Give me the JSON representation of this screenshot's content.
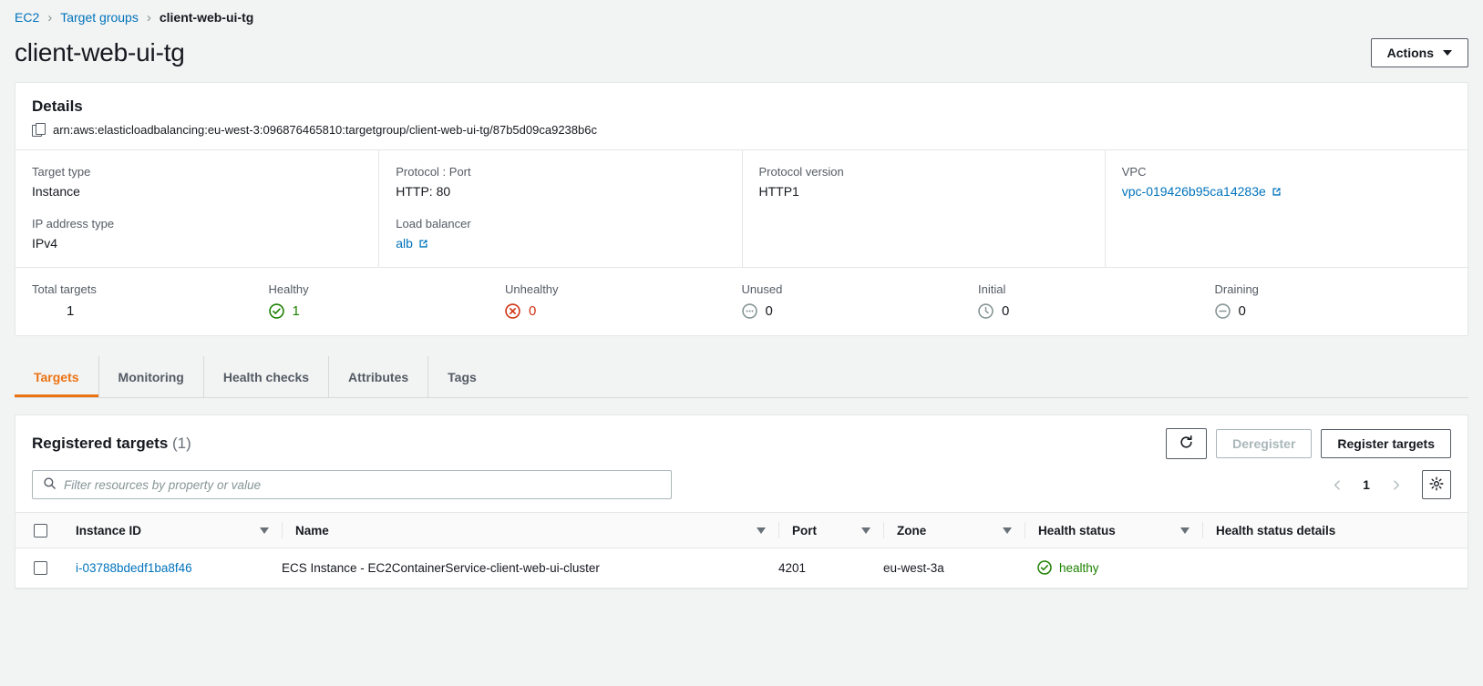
{
  "breadcrumb": {
    "items": [
      {
        "label": "EC2",
        "link": true
      },
      {
        "label": "Target groups",
        "link": true
      },
      {
        "label": "client-web-ui-tg",
        "link": false
      }
    ],
    "separator": "›"
  },
  "header": {
    "title": "client-web-ui-tg",
    "actions_label": "Actions"
  },
  "details": {
    "title": "Details",
    "arn": "arn:aws:elasticloadbalancing:eu-west-3:096876465810:targetgroup/client-web-ui-tg/87b5d09ca9238b6c",
    "attributes": [
      {
        "label": "Target type",
        "value": "Instance"
      },
      {
        "label": "Protocol : Port",
        "value": "HTTP: 80"
      },
      {
        "label": "Protocol version",
        "value": "HTTP1"
      },
      {
        "label": "VPC",
        "value": "vpc-019426b95ca14283e",
        "link": true
      },
      {
        "label": "IP address type",
        "value": "IPv4"
      },
      {
        "label": "Load balancer",
        "value": "alb",
        "link": true
      }
    ]
  },
  "counters": [
    {
      "label": "Total targets",
      "value": "1",
      "icon": "none",
      "color": "gray"
    },
    {
      "label": "Healthy",
      "value": "1",
      "icon": "check-circle-icon",
      "color": "green"
    },
    {
      "label": "Unhealthy",
      "value": "0",
      "icon": "error-circle-icon",
      "color": "red"
    },
    {
      "label": "Unused",
      "value": "0",
      "icon": "ellipsis-circle-icon",
      "color": "gray"
    },
    {
      "label": "Initial",
      "value": "0",
      "icon": "clock-circle-icon",
      "color": "gray"
    },
    {
      "label": "Draining",
      "value": "0",
      "icon": "minus-circle-icon",
      "color": "gray"
    }
  ],
  "tabs": [
    {
      "label": "Targets",
      "active": true
    },
    {
      "label": "Monitoring",
      "active": false
    },
    {
      "label": "Health checks",
      "active": false
    },
    {
      "label": "Attributes",
      "active": false
    },
    {
      "label": "Tags",
      "active": false
    }
  ],
  "table": {
    "title": "Registered targets",
    "count": "(1)",
    "refresh_icon": "refresh-icon",
    "deregister_label": "Deregister",
    "register_label": "Register targets",
    "search_placeholder": "Filter resources by property or value",
    "search_value": "",
    "page_number": "1",
    "columns": [
      {
        "label": "Instance ID",
        "sortable": true
      },
      {
        "label": "Name",
        "sortable": true
      },
      {
        "label": "Port",
        "sortable": true
      },
      {
        "label": "Zone",
        "sortable": true
      },
      {
        "label": "Health status",
        "sortable": true
      },
      {
        "label": "Health status details",
        "sortable": false
      }
    ],
    "rows": [
      {
        "instance_id": "i-03788bdedf1ba8f46",
        "name": "ECS Instance - EC2ContainerService-client-web-ui-cluster",
        "port": "4201",
        "zone": "eu-west-3a",
        "health_status": "healthy",
        "health_status_details": ""
      }
    ]
  },
  "colors": {
    "link": "#0073bb",
    "accent": "#ec7211",
    "healthy": "#1d8102",
    "unhealthy": "#d13212",
    "muted": "#545b64"
  }
}
